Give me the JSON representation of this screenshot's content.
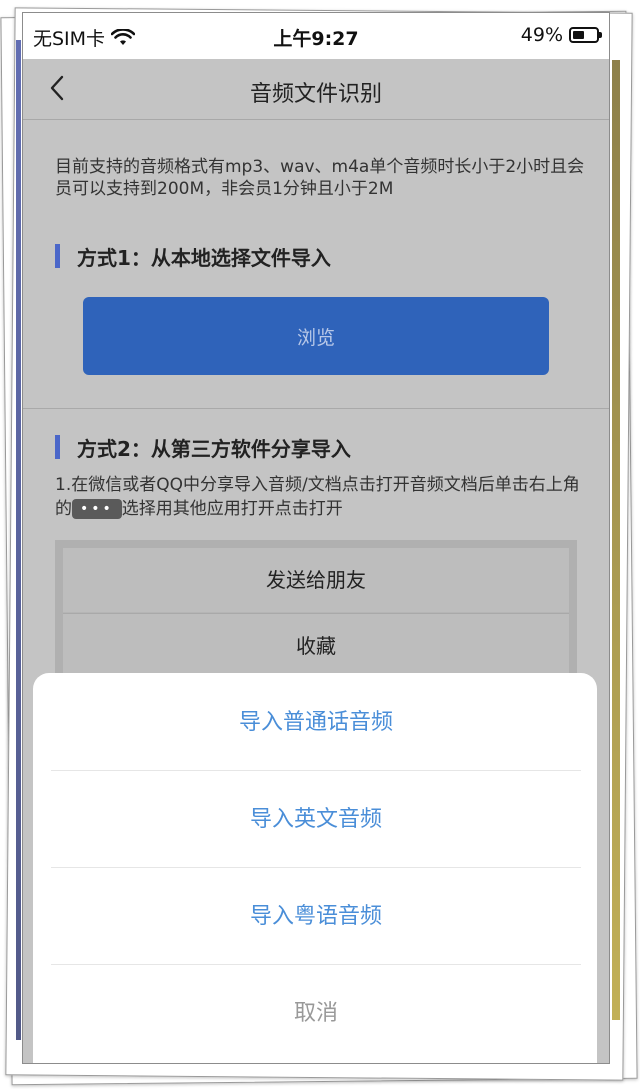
{
  "status_bar": {
    "carrier": "无SIM卡",
    "time": "上午9:27",
    "battery": "49%",
    "battery_level": 0.49
  },
  "nav": {
    "title": "音频文件识别",
    "back_icon": "chevron-left-icon"
  },
  "intro": {
    "description": "目前支持的音频格式有mp3、wav、m4a单个音频时长小于2小时且会员可以支持到200M，非会员1分钟且小于2M"
  },
  "method1": {
    "title": "方式1：从本地选择文件导入",
    "browse_label": "浏览"
  },
  "method2": {
    "title": "方式2：从第三方软件分享导入",
    "step_prefix": "1.在微信或者QQ中分享导入音频/文档点击打开音频文档后单击右上角的",
    "dots_label": "•••",
    "step_suffix": "选择用其他应用打开点击打开",
    "share_options": [
      "发送给朋友",
      "收藏"
    ]
  },
  "action_sheet": {
    "options": [
      "导入普通话音频",
      "导入英文音频",
      "导入粤语音频"
    ],
    "cancel": "取消"
  },
  "colors": {
    "accent": "#2f63ba",
    "sheet_text": "#4a8ed8",
    "section_marker": "#4b67c9"
  }
}
